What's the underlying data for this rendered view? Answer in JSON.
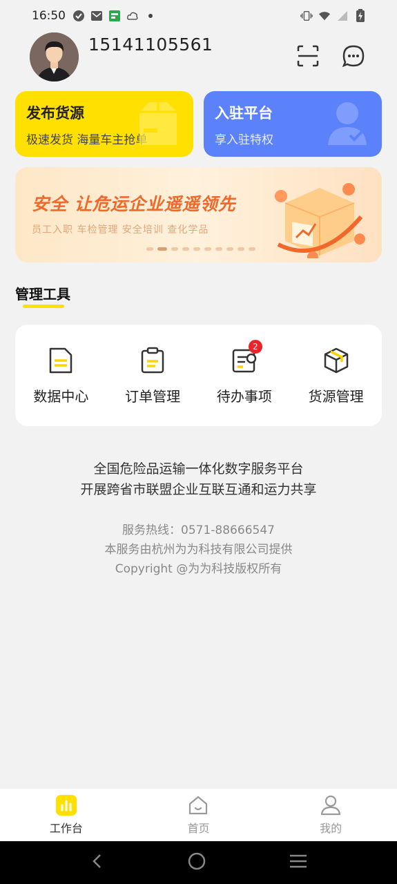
{
  "status_bar": {
    "time": "16:50",
    "left_icons": [
      "check-circle-icon",
      "mail-icon",
      "app-notification-icon",
      "cloud-icon",
      "dot-icon"
    ],
    "right_icons": [
      "vibrate-icon",
      "wifi-icon",
      "signal-icon",
      "battery-charging-icon"
    ]
  },
  "header": {
    "phone": "15141105561",
    "scan_icon": "scan-icon",
    "chat_icon": "chat-icon"
  },
  "cards": {
    "publish": {
      "title": "发布货源",
      "subtitle": "极速发货 海量车主抢单"
    },
    "join": {
      "title": "入驻平台",
      "subtitle": "享入驻特权"
    }
  },
  "banner": {
    "title": "安全 让危运企业遥遥领先",
    "subtitle": "员工入职  车检管理  安全培训  查化学品",
    "total_slides": 10,
    "active_slide": 2
  },
  "section": {
    "title": "管理工具"
  },
  "tools": [
    {
      "label": "数据中心",
      "icon": "document-icon",
      "badge": ""
    },
    {
      "label": "订单管理",
      "icon": "clipboard-icon",
      "badge": ""
    },
    {
      "label": "待办事项",
      "icon": "todo-list-icon",
      "badge": "2"
    },
    {
      "label": "货源管理",
      "icon": "package-icon",
      "badge": ""
    }
  ],
  "footer": {
    "slogan_line1": "全国危险品运输一体化数字服务平台",
    "slogan_line2": "开展跨省市联盟企业互联互通和运力共享",
    "hotline": "服务热线：0571-88666547",
    "provider": "本服务由杭州为为科技有限公司提供",
    "copyright": "Copyright @为为科技版权所有"
  },
  "bottom_nav": [
    {
      "label": "工作台",
      "icon": "workbench-icon",
      "active": true
    },
    {
      "label": "首页",
      "icon": "home-icon",
      "active": false
    },
    {
      "label": "我的",
      "icon": "user-icon",
      "active": false
    }
  ],
  "colors": {
    "accent_yellow": "#ffe000",
    "accent_blue": "#5b82fb",
    "banner_orange": "#f0682a",
    "badge_red": "#e8262a"
  }
}
